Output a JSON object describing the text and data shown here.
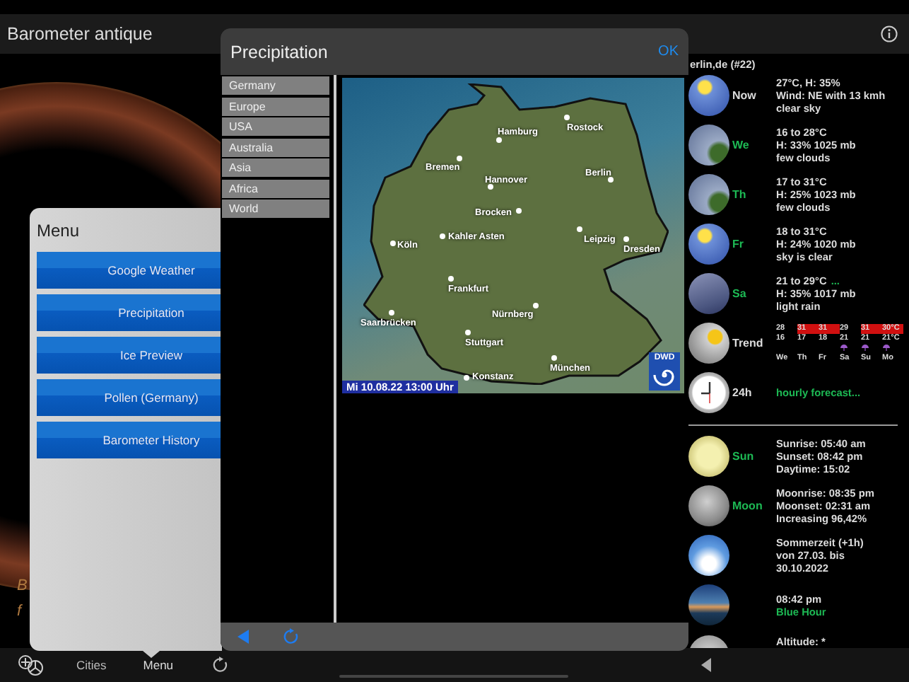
{
  "app_bar": {
    "title": "Barometer antique"
  },
  "background_text": [
    "B",
    "f"
  ],
  "forecast_panel": {
    "location": "erlin,de (#22)",
    "rows": [
      {
        "kind": "sunny",
        "label": "Now",
        "label_accent": false,
        "lines": [
          "27°C, H: 35%",
          "Wind: NE with 13 kmh",
          "clear sky"
        ]
      },
      {
        "kind": "cloudy",
        "label": "We",
        "label_accent": true,
        "lines": [
          "16 to 28°C",
          "H: 33% 1025 mb",
          "few clouds"
        ]
      },
      {
        "kind": "cloudy",
        "label": "Th",
        "label_accent": true,
        "lines": [
          "17 to 31°C",
          "H: 25% 1023 mb",
          "few clouds"
        ]
      },
      {
        "kind": "sunny",
        "label": "Fr",
        "label_accent": true,
        "lines": [
          "18 to 31°C",
          "H: 24% 1020 mb",
          "sky is clear"
        ]
      },
      {
        "kind": "rainy",
        "label": "Sa",
        "label_accent": true,
        "lines": [
          "21 to 29°C",
          "H: 35% 1017 mb",
          "light rain"
        ],
        "more": "..."
      },
      {
        "kind": "trend",
        "label": "Trend",
        "label_accent": false,
        "days": [
          {
            "day": "We",
            "high": "28",
            "low": "16",
            "hot": false,
            "rain": false
          },
          {
            "day": "Th",
            "high": "31",
            "low": "17",
            "hot": true,
            "rain": false
          },
          {
            "day": "Fr",
            "high": "31",
            "low": "18",
            "hot": true,
            "rain": false
          },
          {
            "day": "Sa",
            "high": "29",
            "low": "21",
            "hot": false,
            "rain": true
          },
          {
            "day": "Su",
            "high": "31",
            "low": "21",
            "hot": true,
            "rain": true
          },
          {
            "day": "Mo",
            "high": "30°C",
            "low": "21°C",
            "hot": true,
            "rain": true
          }
        ]
      },
      {
        "kind": "hourly",
        "label": "24h",
        "label_accent": false,
        "accent_line": "hourly forecast..."
      },
      {
        "kind": "divider"
      },
      {
        "kind": "sun",
        "label": "Sun",
        "label_accent": true,
        "lines": [
          "Sunrise: 05:40 am",
          "Sunset: 08:42 pm",
          "Daytime: 15:02"
        ]
      },
      {
        "kind": "moon",
        "label": "Moon",
        "label_accent": true,
        "lines": [
          "Moonrise: 08:35 pm",
          "Moonset: 02:31 am",
          "Increasing 96,42%"
        ]
      },
      {
        "kind": "season",
        "lines": [
          "Sommerzeit (+1h)",
          "von 27.03. bis",
          "30.10.2022"
        ]
      },
      {
        "kind": "bluehour",
        "lines": [
          "08:42 pm"
        ],
        "accent_line": "Blue Hour"
      },
      {
        "kind": "altitude",
        "lines": [
          "Altitude: *"
        ]
      }
    ]
  },
  "menu": {
    "title": "Menu",
    "items": [
      "Google Weather",
      "Precipitation",
      "Ice Preview",
      "Pollen (Germany)",
      "Barometer History"
    ]
  },
  "precipitation_dialog": {
    "title": "Precipitation",
    "ok": "OK",
    "regions": [
      "Germany",
      "Europe",
      "USA",
      "Australia",
      "Asia",
      "Africa",
      "World"
    ],
    "map": {
      "cities": [
        "Hamburg",
        "Rostock",
        "Bremen",
        "Hannover",
        "Berlin",
        "Brocken",
        "Kahler Asten",
        "Köln",
        "Leipzig",
        "Dresden",
        "Frankfurt",
        "Nürnberg",
        "Saarbrücken",
        "Stuttgart",
        "Konstanz",
        "München"
      ],
      "timestamp": "Mi 10.08.22 13:00 Uhr",
      "logo": "DWD"
    }
  },
  "tab_bar": {
    "items": [
      {
        "kind": "icon"
      },
      {
        "kind": "text",
        "label": "Cities",
        "selected": false
      },
      {
        "kind": "text",
        "label": "Menu",
        "selected": true
      },
      {
        "kind": "refresh"
      }
    ]
  }
}
